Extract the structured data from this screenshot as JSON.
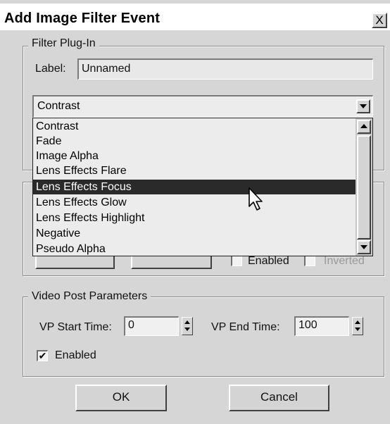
{
  "window": {
    "title": "Add Image Filter Event",
    "close_glyph": "X"
  },
  "filter_plugin": {
    "group_label": "Filter Plug-In",
    "label_caption": "Label:",
    "label_value": "Unnamed",
    "selected": "Contrast",
    "options": [
      "Contrast",
      "Fade",
      "Image Alpha",
      "Lens Effects Flare",
      "Lens Effects Focus",
      "Lens Effects Glow",
      "Lens Effects Highlight",
      "Negative",
      "Pseudo Alpha"
    ],
    "highlighted_option": "Lens Effects Focus"
  },
  "mask": {
    "enabled_label": "Enabled",
    "inverted_label": "Inverted"
  },
  "video_post": {
    "group_label": "Video Post Parameters",
    "start_label": "VP Start Time:",
    "start_value": "0",
    "end_label": "VP End Time:",
    "end_value": "100",
    "enabled_label": "Enabled",
    "enabled_checked": true,
    "check_glyph": "✔"
  },
  "footer": {
    "ok_label": "OK",
    "cancel_label": "Cancel"
  },
  "colors": {
    "dialog_bg": "#d6d6d6",
    "selection_bg": "#2a2a2a",
    "selection_text": "#ffffff"
  },
  "icons": {
    "close": "close-icon",
    "dropdown": "chevron-down-icon",
    "cursor": "mouse-pointer-icon"
  }
}
